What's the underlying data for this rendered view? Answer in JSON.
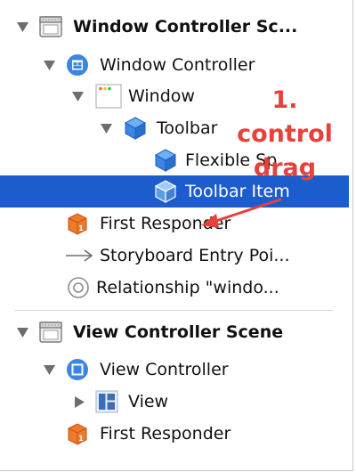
{
  "colors": {
    "selection": "#1c5ccc",
    "annotation": "#e8413b",
    "triangle": "#6e6e6e",
    "cube_blue": "#3b86e0",
    "responder_orange": "#ef7a2b"
  },
  "scenes": [
    {
      "title": "Window Controller Sc...",
      "items": [
        {
          "label": "Window Controller",
          "icon": "window-controller-icon"
        },
        {
          "label": "Window",
          "icon": "window-icon"
        },
        {
          "label": "Toolbar",
          "icon": "toolbar-cube-icon"
        },
        {
          "label": "Flexible Sp...",
          "icon": "flexible-space-cube-icon"
        },
        {
          "label": "Toolbar Item",
          "icon": "toolbar-item-cube-icon",
          "selected": true
        },
        {
          "label": "First Responder",
          "icon": "first-responder-icon"
        },
        {
          "label": "Storyboard Entry Poi...",
          "icon": "entry-point-arrow-icon"
        },
        {
          "label": "Relationship \"windo...",
          "icon": "relationship-icon"
        }
      ]
    },
    {
      "title": "View Controller Scene",
      "items": [
        {
          "label": "View Controller",
          "icon": "view-controller-icon"
        },
        {
          "label": "View",
          "icon": "view-icon"
        },
        {
          "label": "First Responder",
          "icon": "first-responder-icon"
        }
      ]
    }
  ],
  "annotation": {
    "line1": "1. control",
    "line2": "drag"
  }
}
